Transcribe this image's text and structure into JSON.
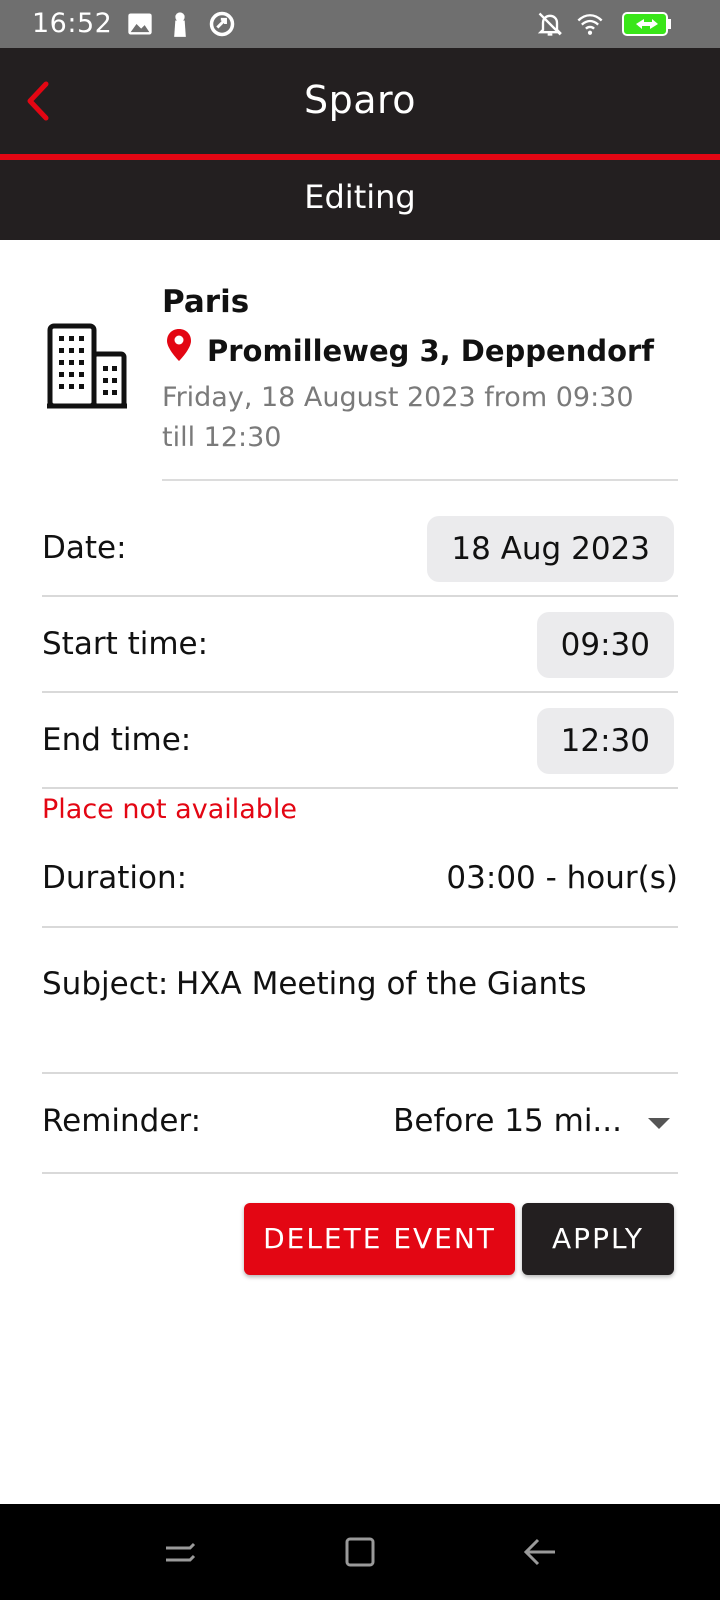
{
  "status_bar": {
    "time": "16:52"
  },
  "app_bar": {
    "title": "Sparo",
    "subtitle": "Editing"
  },
  "event": {
    "place": "Paris",
    "address": "Promilleweg 3, Deppendorf",
    "when": "Friday, 18 August 2023 from 09:30 till 12:30"
  },
  "form": {
    "date_label": "Date:",
    "date_value": "18 Aug 2023",
    "start_label": "Start time:",
    "start_value": "09:30",
    "end_label": "End time:",
    "end_value": "12:30",
    "error": "Place not available",
    "duration_label": "Duration:",
    "duration_value": "03:00 - hour(s)",
    "subject_label": "Subject:",
    "subject_value": "HXA Meeting of the Giants",
    "reminder_label": "Reminder:",
    "reminder_value": "Before 15 mi..."
  },
  "buttons": {
    "delete": "DELETE EVENT",
    "apply": "APPLY"
  },
  "colors": {
    "accent": "#e30613",
    "bar": "#231f20",
    "pill": "#ebebed"
  },
  "icons": [
    "gallery-icon",
    "keyhole-icon",
    "sync-icon",
    "bell-off-icon",
    "wifi-icon",
    "battery-icon",
    "back-icon",
    "building-icon",
    "location-pin-icon",
    "recents-nav-icon",
    "home-nav-icon",
    "back-nav-icon"
  ]
}
